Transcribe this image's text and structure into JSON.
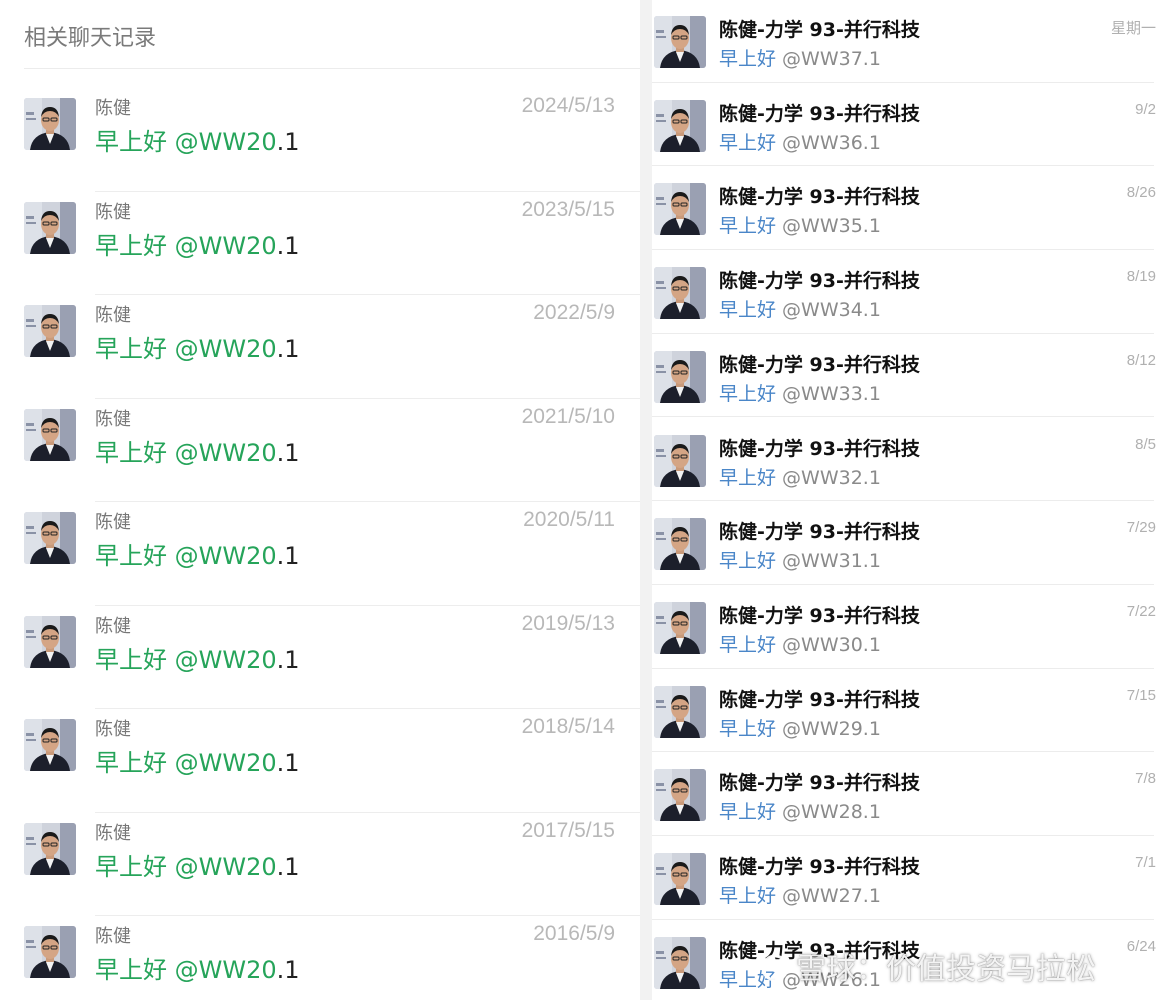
{
  "left_panel": {
    "header": "相关聊天记录",
    "rows": [
      {
        "sender": "陈健",
        "date": "2024/5/13",
        "keyword": "早上好 @WW20",
        "tail": ".1"
      },
      {
        "sender": "陈健",
        "date": "2023/5/15",
        "keyword": "早上好 @WW20",
        "tail": ".1"
      },
      {
        "sender": "陈健",
        "date": "2022/5/9",
        "keyword": "早上好 @WW20",
        "tail": ".1"
      },
      {
        "sender": "陈健",
        "date": "2021/5/10",
        "keyword": "早上好 @WW20",
        "tail": ".1"
      },
      {
        "sender": "陈健",
        "date": "2020/5/11",
        "keyword": "早上好 @WW20",
        "tail": ".1"
      },
      {
        "sender": "陈健",
        "date": "2019/5/13",
        "keyword": "早上好 @WW20",
        "tail": ".1"
      },
      {
        "sender": "陈健",
        "date": "2018/5/14",
        "keyword": "早上好 @WW20",
        "tail": ".1"
      },
      {
        "sender": "陈健",
        "date": "2017/5/15",
        "keyword": "早上好 @WW20",
        "tail": ".1"
      },
      {
        "sender": "陈健",
        "date": "2016/5/9",
        "keyword": "早上好 @WW20",
        "tail": ".1"
      }
    ]
  },
  "right_panel": {
    "rows": [
      {
        "sender": "陈健-力学 93-并行科技",
        "date": "星期一",
        "keyword": "早上好",
        "rest": " @WW37.1"
      },
      {
        "sender": "陈健-力学 93-并行科技",
        "date": "9/2",
        "keyword": "早上好",
        "rest": " @WW36.1"
      },
      {
        "sender": "陈健-力学 93-并行科技",
        "date": "8/26",
        "keyword": "早上好",
        "rest": " @WW35.1"
      },
      {
        "sender": "陈健-力学 93-并行科技",
        "date": "8/19",
        "keyword": "早上好",
        "rest": " @WW34.1"
      },
      {
        "sender": "陈健-力学 93-并行科技",
        "date": "8/12",
        "keyword": "早上好",
        "rest": " @WW33.1"
      },
      {
        "sender": "陈健-力学 93-并行科技",
        "date": "8/5",
        "keyword": "早上好",
        "rest": " @WW32.1"
      },
      {
        "sender": "陈健-力学 93-并行科技",
        "date": "7/29",
        "keyword": "早上好",
        "rest": " @WW31.1"
      },
      {
        "sender": "陈健-力学 93-并行科技",
        "date": "7/22",
        "keyword": "早上好",
        "rest": " @WW30.1"
      },
      {
        "sender": "陈健-力学 93-并行科技",
        "date": "7/15",
        "keyword": "早上好",
        "rest": " @WW29.1"
      },
      {
        "sender": "陈健-力学 93-并行科技",
        "date": "7/8",
        "keyword": "早上好",
        "rest": " @WW28.1"
      },
      {
        "sender": "陈健-力学 93-并行科技",
        "date": "7/1",
        "keyword": "早上好",
        "rest": " @WW27.1"
      },
      {
        "sender": "陈健-力学 93-并行科技",
        "date": "6/24",
        "keyword": "早上好",
        "rest": " @WW26.1"
      }
    ]
  },
  "watermark": {
    "text": "雪球：价值投资马拉松"
  },
  "colors": {
    "left_keyword": "#26a45a",
    "right_keyword": "#4a86c8",
    "date": "#b8b8b8"
  }
}
